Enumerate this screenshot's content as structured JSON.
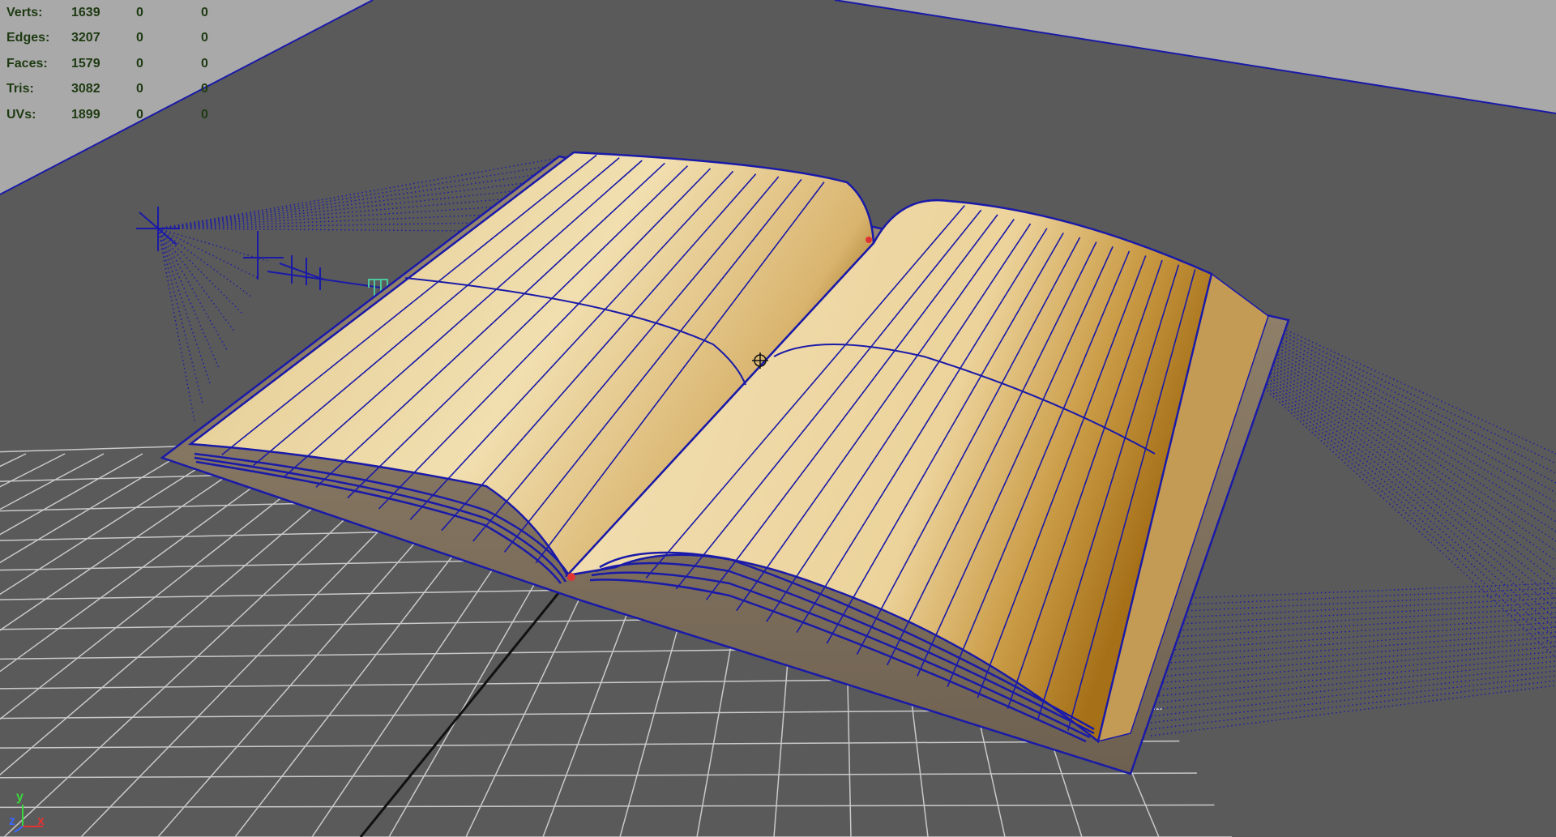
{
  "stats": {
    "rows": [
      {
        "label": "Verts:",
        "v1": "1639",
        "v2": "0",
        "v3": "0"
      },
      {
        "label": "Edges:",
        "v1": "3207",
        "v2": "0",
        "v3": "0"
      },
      {
        "label": "Faces:",
        "v1": "1579",
        "v2": "0",
        "v3": "0"
      },
      {
        "label": "Tris:",
        "v1": "3082",
        "v2": "0",
        "v3": "0"
      },
      {
        "label": "UVs:",
        "v1": "1899",
        "v2": "0",
        "v3": "0"
      }
    ]
  },
  "axis_indicator": {
    "y": "y",
    "z": "z",
    "x": "x"
  },
  "colors": {
    "background": "#5a5a5a",
    "far_plane": "#a9a9a9",
    "grid": "#c9c9c9",
    "wire": "#1a1aa8",
    "hud_text": "#1e3a12",
    "axis_x": "#e03434",
    "axis_y": "#3bd63b",
    "axis_z": "#3a67ff"
  }
}
